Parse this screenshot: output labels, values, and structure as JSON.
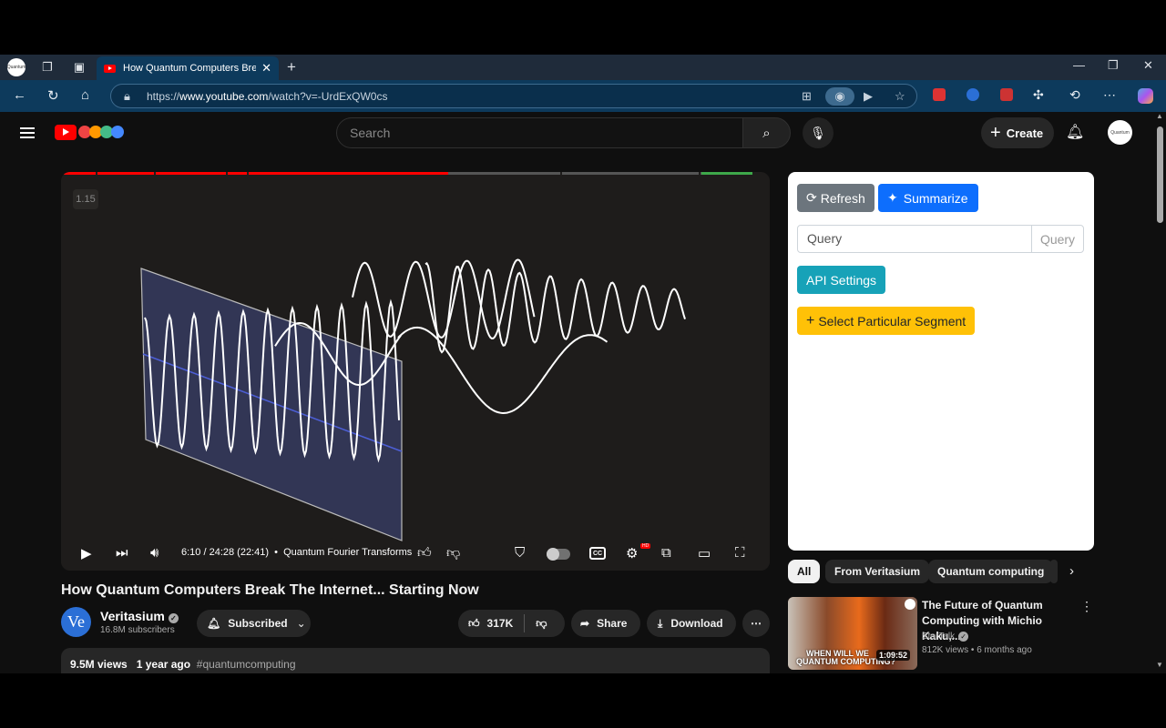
{
  "browser": {
    "tab_title": "How Quantum Computers Break",
    "url_prefix": "https://",
    "url_host": "www.youtube.com",
    "url_path": "/watch?v=-UrdExQW0cs",
    "profile_label": "Quantum"
  },
  "header": {
    "search_placeholder": "Search",
    "create_label": "Create",
    "avatar_label": "Quantum"
  },
  "player": {
    "chapter_tag": "1.15",
    "time": "6:10 / 24:28 (22:41)",
    "chapter": "Quantum Fourier Transforms",
    "cc_label": "CC",
    "hd_label": "HD",
    "progress": 0.56
  },
  "video": {
    "title": "How Quantum Computers Break The Internet... Starting Now",
    "channel": "Veritasium",
    "channel_initials": "Ve",
    "subscribers": "16.8M subscribers",
    "subscribe_label": "Subscribed",
    "likes": "317K",
    "share_label": "Share",
    "download_label": "Download",
    "views": "9.5M views",
    "age": "1 year ago",
    "hashtag": "#quantumcomputing"
  },
  "panel": {
    "refresh_label": "Refresh",
    "summarize_label": "Summarize",
    "query_placeholder": "Query",
    "query_button": "Query",
    "api_settings_label": "API Settings",
    "segment_label": "Select Particular Segment"
  },
  "chips": [
    "All",
    "From Veritasium",
    "Quantum computing"
  ],
  "recommended": {
    "title": "The Future of Quantum Computing with Michio Kaku,...",
    "channel": "StarTalk",
    "views": "812K views",
    "age": "6 months ago",
    "duration": "1:09:52",
    "thumb_text_1": "WHEN WILL WE",
    "thumb_text_2": "QUANTUM COMPUTING?"
  },
  "colors": {
    "refresh_bg": "#6c757d",
    "summarize_bg": "#0d6efd",
    "api_bg": "#17a2b8",
    "segment_bg": "#ffc107",
    "progress_played": "#f00",
    "progress_end": "#3ea84a"
  }
}
